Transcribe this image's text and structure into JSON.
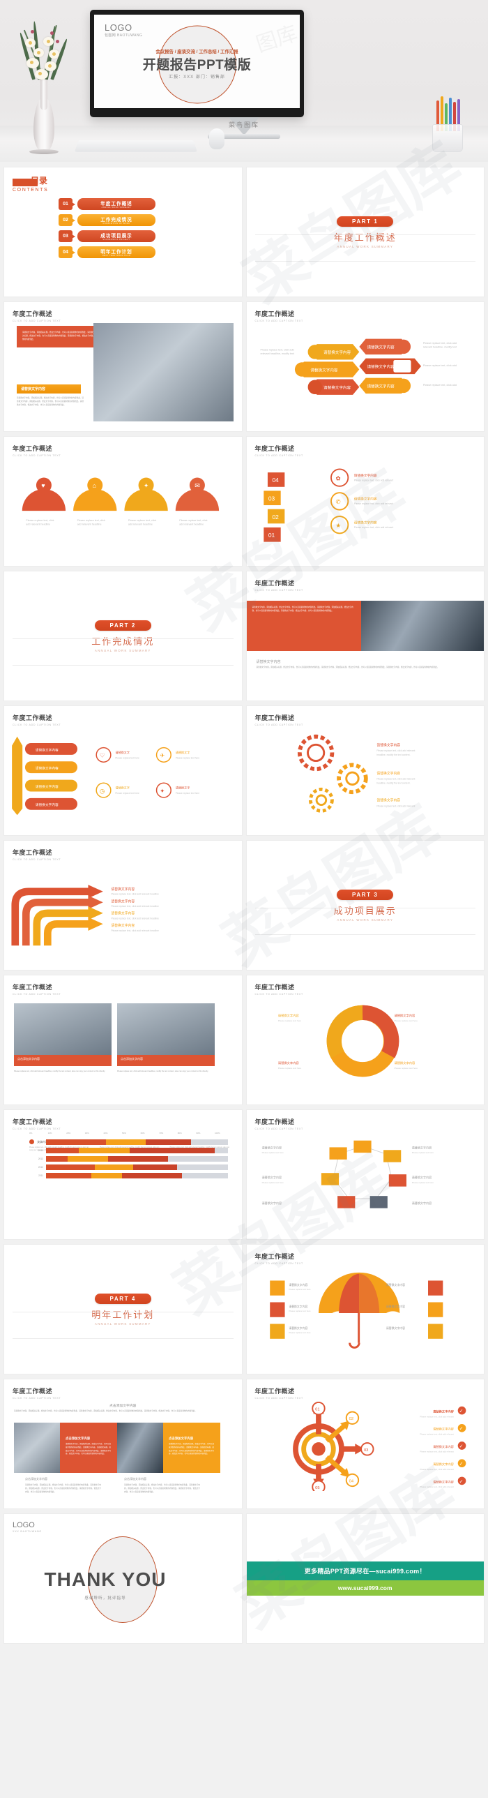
{
  "hero": {
    "logo": "LOGO",
    "logo_sub": "包图网 BAOTUWANG",
    "kicker": "会议报告 / 座谈交流 / 工作总结 / 工作汇报",
    "title": "开题报告PPT模版",
    "meta": "汇报：XXX        部门：销售部",
    "brand": "菜鸟图库",
    "watermark": "图库"
  },
  "contents": {
    "cn": "目录",
    "en": "CONTENTS",
    "items": [
      {
        "num": "01",
        "cn": "年度工作概述",
        "en": "ANNUAL WORK SUMMARY",
        "color": "#d8502a"
      },
      {
        "num": "02",
        "cn": "工作完成情况",
        "en": "COMPLETION OF WORK",
        "color": "#f5a11b"
      },
      {
        "num": "03",
        "cn": "成功项目展示",
        "en": "SUCCESSFUL PROJECT",
        "color": "#d8502a"
      },
      {
        "num": "04",
        "cn": "明年工作计划",
        "en": "NEXT YEAR WORK PLAN",
        "color": "#f5a11b"
      }
    ]
  },
  "sections": {
    "p1": {
      "pill": "PART  1",
      "cn": "年度工作概述",
      "en": "ANNUAL WORK SUMMARY"
    },
    "p2": {
      "pill": "PART  2",
      "cn": "工作完成情况",
      "en": "ANNUAL WORK SUMMARY"
    },
    "p3": {
      "pill": "PART  3",
      "cn": "成功项目展示",
      "en": "ANNUAL WORK SUMMARY"
    },
    "p4": {
      "pill": "PART  4",
      "cn": "明年工作计划",
      "en": "ANNUAL WORK SUMMARY"
    }
  },
  "slide_header": {
    "title": "年度工作概述",
    "title_b": "工作完成情况",
    "sub": "CLICK TO ADD CAPTION TEXT"
  },
  "body_text": {
    "lorem_cn": "请替换文字内容，添加相关标题，修改文字内容，也可以直接复制你的内容到此。请替换文字内容，添加相关标题，修改文字内容，也可以直接复制你的内容到此。请替换文字内容，修改文字内容，也可以直接复制你的内容到此。",
    "lorem_en": "Please replace text, click add relevant headline, modify the text content, also can copy your content to this directly.",
    "caption": "点击添加文字内容",
    "label": "请替换文字内容"
  },
  "chart_data": {
    "type": "bar",
    "orientation": "horizontal",
    "stacked": true,
    "categories": [
      "2015",
      "2014",
      "2013",
      "2012",
      "2011"
    ],
    "series": [
      {
        "name": "文字内容",
        "color": "#d8502a",
        "values": [
          33,
          18,
          12,
          27,
          25
        ]
      },
      {
        "name": "文字内容",
        "color": "#f5a11b",
        "values": [
          22,
          28,
          22,
          21,
          17
        ]
      },
      {
        "name": "文字内容",
        "color": "#c9432a",
        "values": [
          25,
          47,
          33,
          24,
          33
        ]
      }
    ],
    "remainder_color": "#d5d8de",
    "xticks": [
      "0%",
      "10%",
      "20%",
      "30%",
      "40%",
      "50%",
      "60%",
      "70%",
      "80%",
      "90%",
      "100%"
    ],
    "xlim": [
      0,
      100
    ],
    "ylabel": "",
    "xlabel": "",
    "title": "年度工作概述",
    "legend": [
      {
        "label": "文字内容",
        "color": "#d8502a",
        "desc": "Please replace text, click add relevant headline, modify the text content, also can copy your content to this directly."
      },
      {
        "label": "文字内容",
        "color": "#f5a11b",
        "desc": "Please replace text, click add relevant headline, modify the text content, also can copy your content to this directly."
      },
      {
        "label": "文字内容",
        "color": "#c9432a",
        "desc": "Please replace text, click add relevant headline, modify the text content, also can copy your content to this directly."
      }
    ],
    "grid": false,
    "legend_position": "bottom"
  },
  "thankyou": {
    "logo": "LOGO",
    "logo_sub": "XXX  BAOTUWANG",
    "big": "THANK YOU",
    "small": "感谢聆听，批评指导"
  },
  "promo": {
    "line1": "更多精品PPT资源尽在—sucai999.com！",
    "line2": "www.sucai999.com",
    "color1": "#16a085",
    "color2": "#8cc63f"
  },
  "badges": {
    "steps": [
      "01",
      "02",
      "03",
      "04",
      "05"
    ],
    "nums": [
      "01",
      "02",
      "03",
      "04"
    ]
  }
}
